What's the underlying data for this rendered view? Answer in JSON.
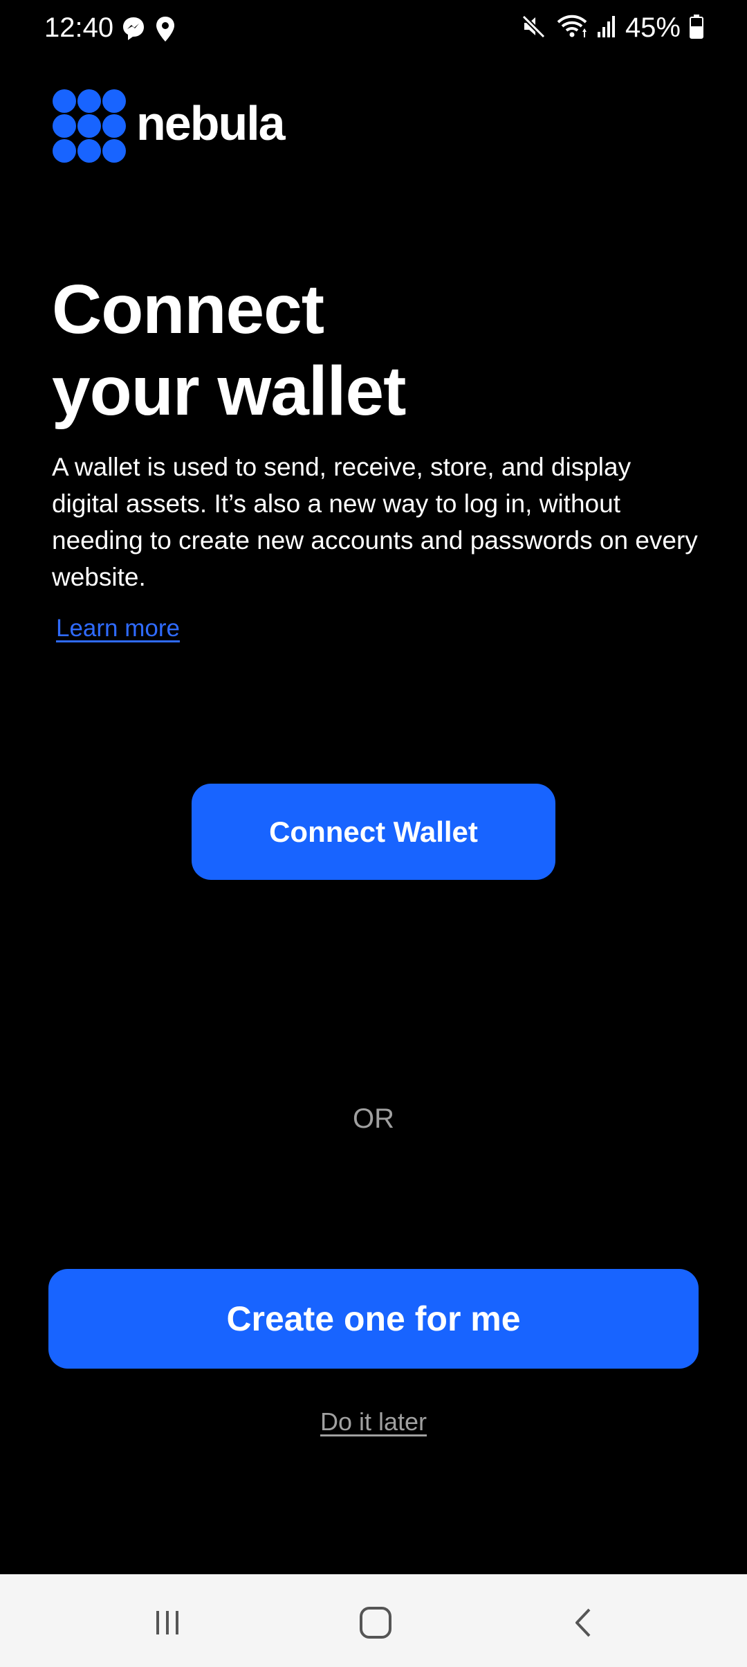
{
  "status_bar": {
    "time": "12:40",
    "battery": "45%",
    "left_icons": [
      "messenger-icon",
      "location-icon"
    ],
    "right_icons": [
      "mute-icon",
      "wifi-icon",
      "signal-icon",
      "battery-icon"
    ]
  },
  "brand": {
    "name": "nebula",
    "logo_icon": "nine-dot-grid-icon",
    "accent_color": "#1864ff"
  },
  "main": {
    "title_line1": "Connect",
    "title_line2": "your wallet",
    "description": "A wallet is used to send, receive, store, and display digital assets. It’s also a new way to log in, without needing to create new accounts and passwords on every website.",
    "learn_more": "Learn more",
    "connect_button": "Connect Wallet",
    "or_separator": "OR",
    "create_button": "Create one for me",
    "later_link": "Do it later"
  },
  "nav_bar": {
    "items": [
      "recent-apps-icon",
      "home-icon",
      "back-icon"
    ]
  }
}
